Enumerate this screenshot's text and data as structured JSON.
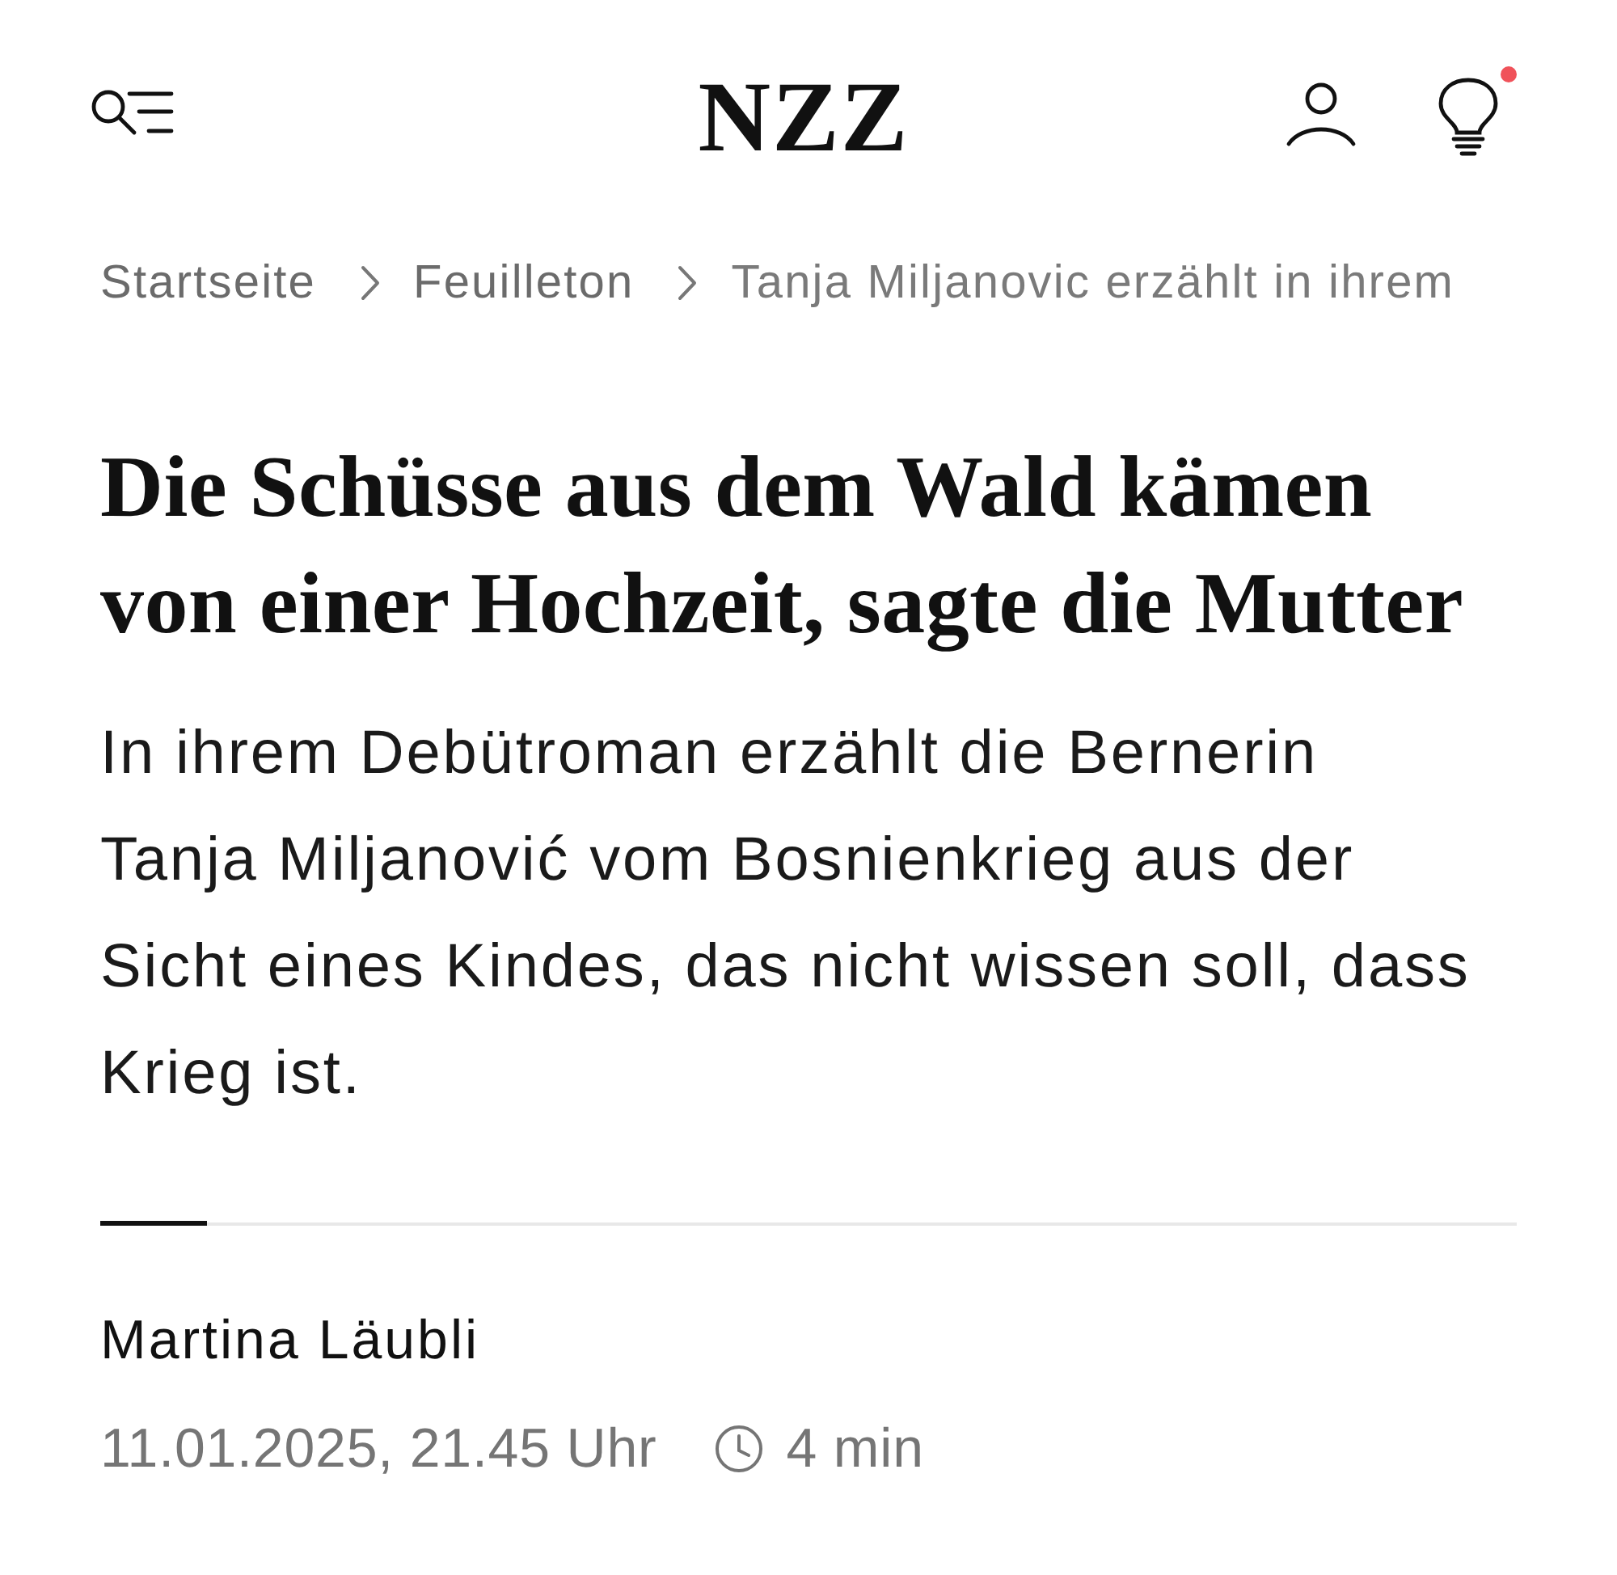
{
  "header": {
    "logo": "NZZ",
    "has_notification": true
  },
  "breadcrumb": [
    {
      "label": "Startseite"
    },
    {
      "label": "Feuilleton"
    },
    {
      "label": "Tanja Miljanovic erzählt in ihrem"
    }
  ],
  "article": {
    "title": "Die Schüsse aus dem Wald kämen von einer Hochzeit, sagte die Mutter",
    "lead": "In ihrem Debütroman erzählt die Bernerin Tanja Miljanović vom Bosnienkrieg aus der Sicht eines Kindes, das nicht wissen soll, dass Krieg ist.",
    "author": "Martina Läubli",
    "date": "11.01.2025, 21.45 Uhr",
    "reading_time": "4 min"
  }
}
